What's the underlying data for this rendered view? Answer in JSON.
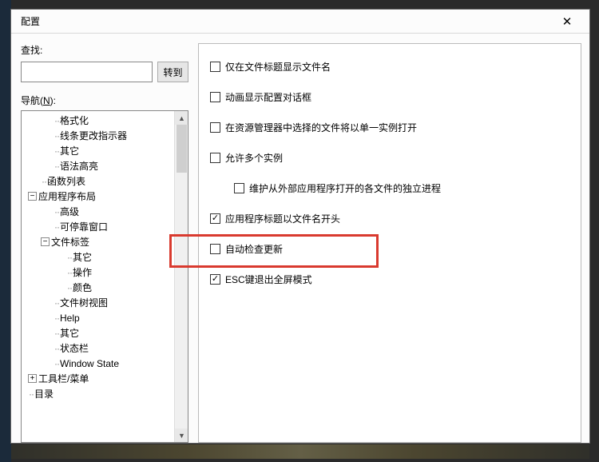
{
  "window": {
    "title": "配置",
    "close_icon": "✕"
  },
  "find": {
    "label": "查找:",
    "value": "",
    "goto_label": "转到"
  },
  "nav": {
    "label_prefix": "导航(",
    "label_hotkey": "N",
    "label_suffix": "):"
  },
  "tree": [
    {
      "depth": 2,
      "expander": null,
      "label": "格式化"
    },
    {
      "depth": 2,
      "expander": null,
      "label": "线条更改指示器"
    },
    {
      "depth": 2,
      "expander": null,
      "label": "其它"
    },
    {
      "depth": 2,
      "expander": null,
      "label": "语法高亮"
    },
    {
      "depth": 1,
      "expander": null,
      "label": "函数列表"
    },
    {
      "depth": 0,
      "expander": "minus",
      "label": "应用程序布局"
    },
    {
      "depth": 2,
      "expander": null,
      "label": "高级"
    },
    {
      "depth": 2,
      "expander": null,
      "label": "可停靠窗口"
    },
    {
      "depth": 1,
      "expander": "minus",
      "label": "文件标签"
    },
    {
      "depth": 3,
      "expander": null,
      "label": "其它"
    },
    {
      "depth": 3,
      "expander": null,
      "label": "操作"
    },
    {
      "depth": 3,
      "expander": null,
      "label": "颜色"
    },
    {
      "depth": 2,
      "expander": null,
      "label": "文件树视图"
    },
    {
      "depth": 2,
      "expander": null,
      "label": "Help"
    },
    {
      "depth": 2,
      "expander": null,
      "label": "其它"
    },
    {
      "depth": 2,
      "expander": null,
      "label": "状态栏"
    },
    {
      "depth": 2,
      "expander": null,
      "label": "Window State"
    },
    {
      "depth": 0,
      "expander": "plus",
      "label": "工具栏/菜单"
    },
    {
      "depth": 0,
      "expander": null,
      "label": "目录"
    }
  ],
  "options": [
    {
      "key": "only_filename_in_title",
      "label": "仅在文件标题显示文件名",
      "checked": false,
      "indent": false
    },
    {
      "key": "animate_config_dialog",
      "label": "动画显示配置对话框",
      "checked": false,
      "indent": false
    },
    {
      "key": "single_instance_explorer",
      "label": "在资源管理器中选择的文件将以单一实例打开",
      "checked": false,
      "indent": false
    },
    {
      "key": "allow_multi_instance",
      "label": "允许多个实例",
      "checked": false,
      "indent": false
    },
    {
      "key": "maintain_external_process",
      "label": "维护从外部应用程序打开的各文件的独立进程",
      "checked": false,
      "indent": true
    },
    {
      "key": "app_title_prefix_filename",
      "label": "应用程序标题以文件名开头",
      "checked": true,
      "indent": false
    },
    {
      "key": "auto_check_update",
      "label": "自动检查更新",
      "checked": false,
      "indent": false,
      "highlight": true
    },
    {
      "key": "esc_exit_fullscreen",
      "label": "ESC键退出全屏模式",
      "checked": true,
      "indent": false
    }
  ],
  "scroll": {
    "up": "▲",
    "down": "▼"
  },
  "expander_glyph": {
    "plus": "+",
    "minus": "−"
  }
}
